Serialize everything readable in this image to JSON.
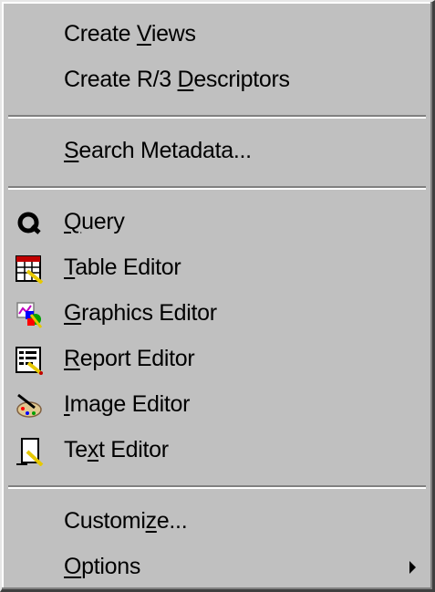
{
  "menu": {
    "group1": [
      {
        "pre": "Create ",
        "acc": "V",
        "post": "iews"
      },
      {
        "pre": "Create R/3 ",
        "acc": "D",
        "post": "escriptors"
      }
    ],
    "group2": [
      {
        "pre": "",
        "acc": "S",
        "post": "earch Metadata..."
      }
    ],
    "group3": [
      {
        "pre": "",
        "acc": "Q",
        "post": "uery",
        "icon": "query-icon"
      },
      {
        "pre": "",
        "acc": "T",
        "post": "able Editor",
        "icon": "table-editor-icon"
      },
      {
        "pre": "",
        "acc": "G",
        "post": "raphics Editor",
        "icon": "graphics-editor-icon"
      },
      {
        "pre": "",
        "acc": "R",
        "post": "eport Editor",
        "icon": "report-editor-icon"
      },
      {
        "pre": "",
        "acc": "I",
        "post": "mage Editor",
        "icon": "image-editor-icon"
      },
      {
        "pre": "Te",
        "acc": "x",
        "post": "t Editor",
        "icon": "text-editor-icon"
      }
    ],
    "group4": [
      {
        "pre": "Customi",
        "acc": "z",
        "post": "e..."
      },
      {
        "pre": "",
        "acc": "O",
        "post": "ptions",
        "submenu_icon": "submenu-arrow-icon"
      }
    ]
  }
}
